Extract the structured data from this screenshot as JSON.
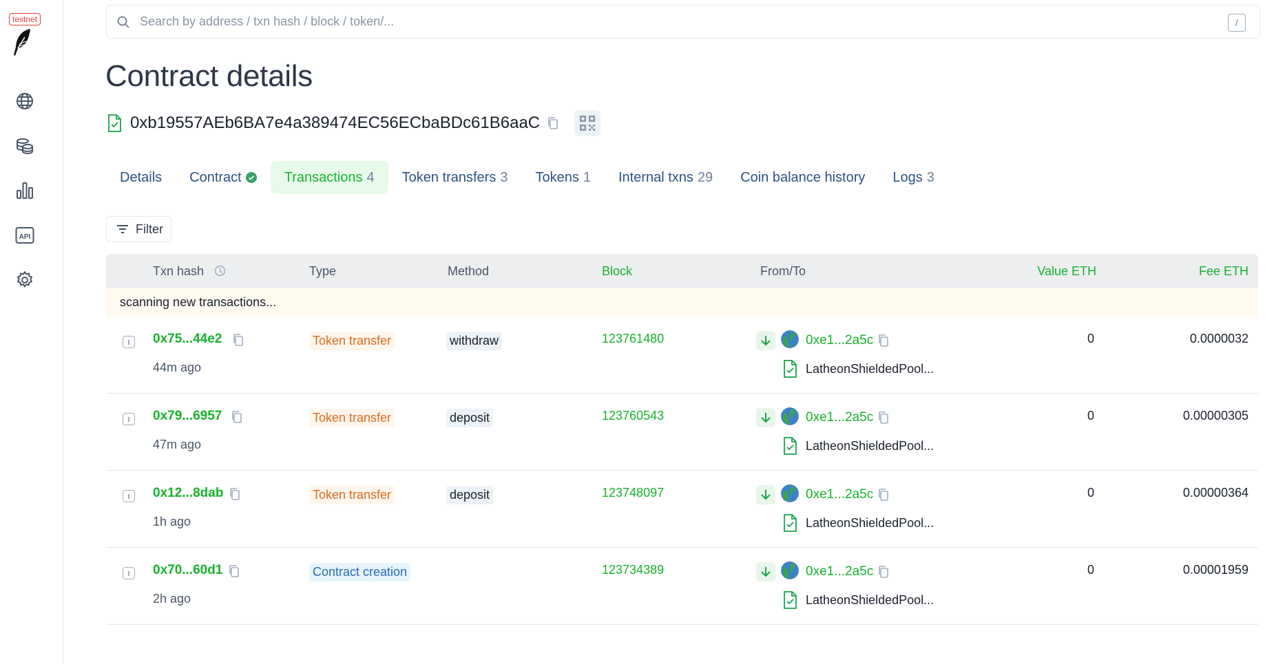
{
  "sidebar": {
    "badge": "testnet",
    "nav": [
      {
        "icon": "globe-icon"
      },
      {
        "icon": "coins-icon"
      },
      {
        "icon": "bar-chart-icon"
      },
      {
        "icon": "api-icon"
      },
      {
        "icon": "gear-icon"
      }
    ]
  },
  "search": {
    "placeholder": "Search by address / txn hash / block / token/...",
    "shortcut": "/"
  },
  "page": {
    "title": "Contract details",
    "address": "0xb19557AEb6BA7e4a389474EC56ECbaBDc61B6aaC"
  },
  "tabs": [
    {
      "label": "Details",
      "count": ""
    },
    {
      "label": "Contract",
      "count": ""
    },
    {
      "label": "Transactions",
      "count": "4"
    },
    {
      "label": "Token transfers",
      "count": "3"
    },
    {
      "label": "Tokens",
      "count": "1"
    },
    {
      "label": "Internal txns",
      "count": "29"
    },
    {
      "label": "Coin balance history",
      "count": ""
    },
    {
      "label": "Logs",
      "count": "3"
    }
  ],
  "filter_label": "Filter",
  "table": {
    "headers": {
      "txn_hash": "Txn hash",
      "type": "Type",
      "method": "Method",
      "block": "Block",
      "from_to": "From/To",
      "value": "Value ETH",
      "fee": "Fee ETH"
    },
    "scanning": "scanning new transactions...",
    "rows": [
      {
        "hash": "0x75...44e2",
        "age": "44m ago",
        "type": "Token transfer",
        "method": "withdraw",
        "block": "123761480",
        "from": "0xe1...2a5c",
        "to": "LatheonShieldedPool...",
        "value": "0",
        "fee": "0.0000032"
      },
      {
        "hash": "0x79...6957",
        "age": "47m ago",
        "type": "Token transfer",
        "method": "deposit",
        "block": "123760543",
        "from": "0xe1...2a5c",
        "to": "LatheonShieldedPool...",
        "value": "0",
        "fee": "0.00000305"
      },
      {
        "hash": "0x12...8dab",
        "age": "1h ago",
        "type": "Token transfer",
        "method": "deposit",
        "block": "123748097",
        "from": "0xe1...2a5c",
        "to": "LatheonShieldedPool...",
        "value": "0",
        "fee": "0.00000364"
      },
      {
        "hash": "0x70...60d1",
        "age": "2h ago",
        "type": "Contract creation",
        "method": "",
        "block": "123734389",
        "from": "0xe1...2a5c",
        "to": "LatheonShieldedPool...",
        "value": "0",
        "fee": "0.00001959"
      }
    ]
  }
}
